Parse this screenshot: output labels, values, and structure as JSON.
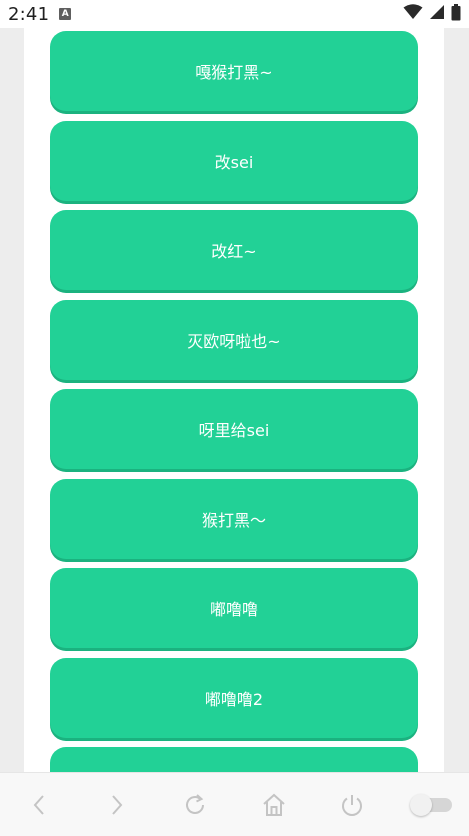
{
  "status_bar": {
    "time": "2:41",
    "notification_badge": "A",
    "icons": [
      "wifi-icon",
      "signal-icon",
      "battery-icon"
    ]
  },
  "buttons": [
    {
      "label": "嘎猴打黑~"
    },
    {
      "label": "改sei"
    },
    {
      "label": "改红~"
    },
    {
      "label": "灭欧呀啦也~"
    },
    {
      "label": "呀里给sei"
    },
    {
      "label": "猴打黑～"
    },
    {
      "label": "嘟噜噜"
    },
    {
      "label": "嘟噜噜2"
    },
    {
      "label": ""
    }
  ],
  "bottom_nav": {
    "items": [
      "back-icon",
      "forward-icon",
      "refresh-icon",
      "home-icon",
      "power-icon",
      "toggle-switch"
    ]
  },
  "colors": {
    "button_bg": "#22d196",
    "button_shadow": "#1bb27f",
    "button_text": "#ffffff",
    "page_bg": "#ededed"
  }
}
